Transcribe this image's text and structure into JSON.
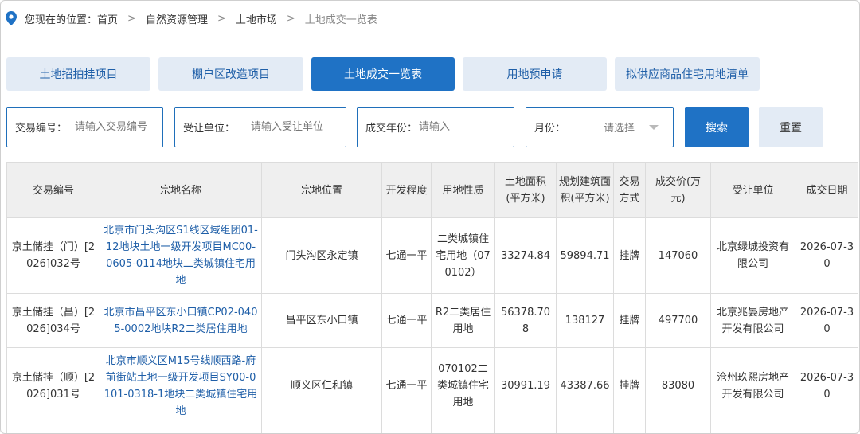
{
  "breadcrumb": {
    "prefix": "您现在的位置：",
    "items": [
      "首页",
      "自然资源管理",
      "土地市场"
    ],
    "current": "土地成交一览表"
  },
  "tabs": [
    {
      "label": "土地招拍挂项目",
      "active": false
    },
    {
      "label": "棚户区改造项目",
      "active": false
    },
    {
      "label": "土地成交一览表",
      "active": true
    },
    {
      "label": "用地预申请",
      "active": false
    },
    {
      "label": "拟供应商品住宅用地清单",
      "active": false
    }
  ],
  "filters": {
    "deal_no": {
      "label": "交易编号：",
      "placeholder": "请输入交易编号"
    },
    "grantee": {
      "label": "受让单位：",
      "placeholder": "请输入受让单位"
    },
    "year": {
      "label": "成交年份：",
      "placeholder": "请输入"
    },
    "month": {
      "label": "月份：",
      "selected": "请选择"
    }
  },
  "buttons": {
    "search": "搜索",
    "reset": "重置"
  },
  "table": {
    "headers": [
      "交易编号",
      "宗地名称",
      "宗地位置",
      "开发程度",
      "用地性质",
      "土地面积(平方米)",
      "规划建筑面积(平方米)",
      "交易方式",
      "成交价(万元)",
      "受让单位",
      "成交日期"
    ],
    "rows": [
      [
        "京土储挂（门）[2026]032号",
        "北京市门头沟区S1线区域组团01-12地块土地一级开发项目MC00-0605-0114地块二类城镇住宅用地",
        "门头沟区永定镇",
        "七通一平",
        "二类城镇住宅用地（070102）",
        "33274.84",
        "59894.71",
        "挂牌",
        "147060",
        "北京绿城投资有限公司",
        "2026-07-30"
      ],
      [
        "京土储挂（昌）[2026]034号",
        "北京市昌平区东小口镇CP02-0405-0002地块R2二类居住用地",
        "昌平区东小口镇",
        "七通一平",
        "R2二类居住用地",
        "56378.708",
        "138127",
        "挂牌",
        "497700",
        "北京兆晏房地产开发有限公司",
        "2026-07-30"
      ],
      [
        "京土储挂（顺）[2026]031号",
        "北京市顺义区M15号线顺西路-府前街站土地一级开发项目SY00-0101-0318-1地块二类城镇住宅用地",
        "顺义区仁和镇",
        "七通一平",
        "070102二类城镇住宅用地",
        "30991.19",
        "43387.66",
        "挂牌",
        "83080",
        "沧州玖熙房地产开发有限公司",
        "2026-07-30"
      ]
    ]
  },
  "colors": {
    "primary": "#1f72c5",
    "tab_inactive_bg": "#e3ebf5",
    "link": "#1f5fa8",
    "header_bg": "#efefef",
    "border": "#dcdcdc"
  },
  "icons": {
    "breadcrumb": "location-pin-icon",
    "month_select": "chevron-down-icon"
  }
}
